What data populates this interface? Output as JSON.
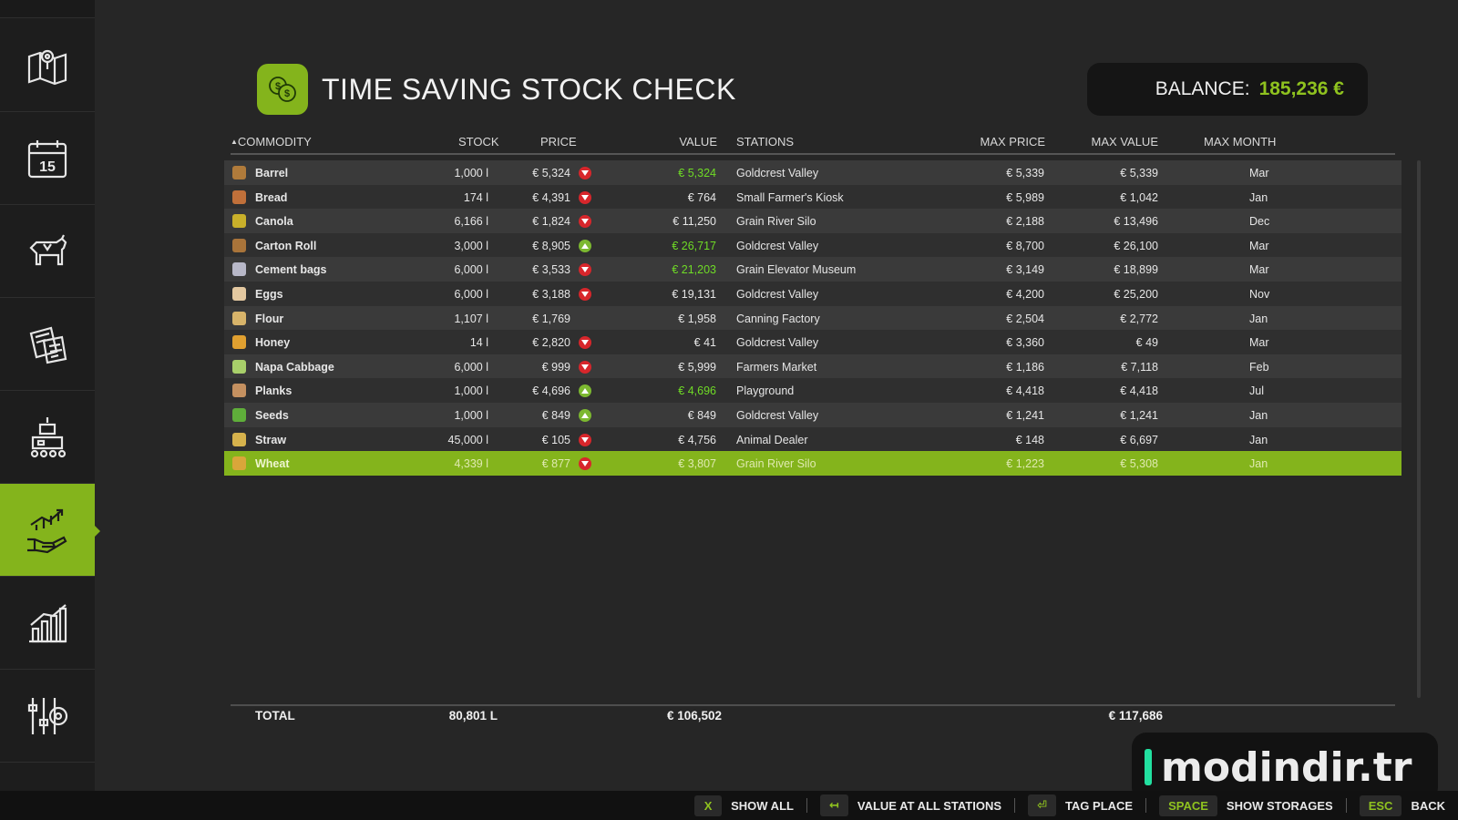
{
  "header": {
    "title": "TIME SAVING STOCK CHECK",
    "balance_label": "BALANCE:",
    "balance_value": "185,236 €"
  },
  "sidebar": {
    "items": [
      {
        "name": "map-icon"
      },
      {
        "name": "calendar-icon",
        "label": "15"
      },
      {
        "name": "animals-icon"
      },
      {
        "name": "contracts-icon"
      },
      {
        "name": "production-icon"
      },
      {
        "name": "prices-icon",
        "active": true
      },
      {
        "name": "statistics-icon"
      },
      {
        "name": "settings-icon"
      }
    ]
  },
  "columns": {
    "commodity": "COMMODITY",
    "stock": "STOCK",
    "price": "PRICE",
    "value": "VALUE",
    "stations": "STATIONS",
    "max_price": "MAX PRICE",
    "max_value": "MAX VALUE",
    "max_month": "MAX MONTH"
  },
  "rows": [
    {
      "name": "Barrel",
      "stock": "1,000 l",
      "price": "€ 5,324",
      "trend": "down",
      "value": "€ 5,324",
      "value_green": true,
      "station": "Goldcrest Valley",
      "max_price": "€ 5,339",
      "max_value": "€ 5,339",
      "max_month": "Mar",
      "icon_color": "#b07b3b"
    },
    {
      "name": "Bread",
      "stock": "174 l",
      "price": "€ 4,391",
      "trend": "down",
      "value": "€ 764",
      "value_green": false,
      "station": "Small Farmer's Kiosk",
      "max_price": "€ 5,989",
      "max_value": "€ 1,042",
      "max_month": "Jan",
      "icon_color": "#c0703a"
    },
    {
      "name": "Canola",
      "stock": "6,166 l",
      "price": "€ 1,824",
      "trend": "down",
      "value": "€ 11,250",
      "value_green": false,
      "station": "Grain River Silo",
      "max_price": "€ 2,188",
      "max_value": "€ 13,496",
      "max_month": "Dec",
      "icon_color": "#c9b02a"
    },
    {
      "name": "Carton Roll",
      "stock": "3,000 l",
      "price": "€ 8,905",
      "trend": "up",
      "value": "€ 26,717",
      "value_green": true,
      "station": "Goldcrest Valley",
      "max_price": "€ 8,700",
      "max_value": "€ 26,100",
      "max_month": "Mar",
      "icon_color": "#a9743a"
    },
    {
      "name": "Cement bags",
      "stock": "6,000 l",
      "price": "€ 3,533",
      "trend": "down",
      "value": "€ 21,203",
      "value_green": true,
      "station": "Grain Elevator Museum",
      "max_price": "€ 3,149",
      "max_value": "€ 18,899",
      "max_month": "Mar",
      "icon_color": "#b8b8c8"
    },
    {
      "name": "Eggs",
      "stock": "6,000 l",
      "price": "€ 3,188",
      "trend": "down",
      "value": "€ 19,131",
      "value_green": false,
      "station": "Goldcrest Valley",
      "max_price": "€ 4,200",
      "max_value": "€ 25,200",
      "max_month": "Nov",
      "icon_color": "#e3c8a0"
    },
    {
      "name": "Flour",
      "stock": "1,107 l",
      "price": "€ 1,769",
      "trend": "none",
      "value": "€ 1,958",
      "value_green": false,
      "station": "Canning Factory",
      "max_price": "€ 2,504",
      "max_value": "€ 2,772",
      "max_month": "Jan",
      "icon_color": "#d8b46a"
    },
    {
      "name": "Honey",
      "stock": "14 l",
      "price": "€ 2,820",
      "trend": "down",
      "value": "€ 41",
      "value_green": false,
      "station": "Goldcrest Valley",
      "max_price": "€ 3,360",
      "max_value": "€ 49",
      "max_month": "Mar",
      "icon_color": "#e0a030"
    },
    {
      "name": "Napa Cabbage",
      "stock": "6,000 l",
      "price": "€ 999",
      "trend": "down",
      "value": "€ 5,999",
      "value_green": false,
      "station": "Farmers Market",
      "max_price": "€ 1,186",
      "max_value": "€ 7,118",
      "max_month": "Feb",
      "icon_color": "#a8cf6a"
    },
    {
      "name": "Planks",
      "stock": "1,000 l",
      "price": "€ 4,696",
      "trend": "up",
      "value": "€ 4,696",
      "value_green": true,
      "station": "Playground",
      "max_price": "€ 4,418",
      "max_value": "€ 4,418",
      "max_month": "Jul",
      "icon_color": "#c49060"
    },
    {
      "name": "Seeds",
      "stock": "1,000 l",
      "price": "€ 849",
      "trend": "up",
      "value": "€ 849",
      "value_green": false,
      "station": "Goldcrest Valley",
      "max_price": "€ 1,241",
      "max_value": "€ 1,241",
      "max_month": "Jan",
      "icon_color": "#5fae3a"
    },
    {
      "name": "Straw",
      "stock": "45,000 l",
      "price": "€ 105",
      "trend": "down",
      "value": "€ 4,756",
      "value_green": false,
      "station": "Animal Dealer",
      "max_price": "€ 148",
      "max_value": "€ 6,697",
      "max_month": "Jan",
      "icon_color": "#d6b24c"
    },
    {
      "name": "Wheat",
      "stock": "4,339 l",
      "price": "€ 877",
      "trend": "down",
      "value": "€ 3,807",
      "value_green": false,
      "station": "Grain River Silo",
      "max_price": "€ 1,223",
      "max_value": "€ 5,308",
      "max_month": "Jan",
      "icon_color": "#d9a63a",
      "selected": true
    }
  ],
  "totals": {
    "label": "TOTAL",
    "stock": "80,801 L",
    "value": "€ 106,502",
    "max_value": "€ 117,686"
  },
  "watermark": "modindir.tr",
  "bottom_bar": [
    {
      "key": "X",
      "label": "SHOW ALL"
    },
    {
      "key": "↤",
      "label": "VALUE AT ALL STATIONS"
    },
    {
      "key": "⏎",
      "label": "TAG PLACE"
    },
    {
      "key": "SPACE",
      "label": "SHOW STORAGES"
    },
    {
      "key": "ESC",
      "label": "BACK"
    }
  ],
  "colors": {
    "accent": "#84b41c",
    "balance": "#8fc21f",
    "trend_down": "#d7262b",
    "trend_up": "#7cb830",
    "value_green": "#6fdb26"
  }
}
